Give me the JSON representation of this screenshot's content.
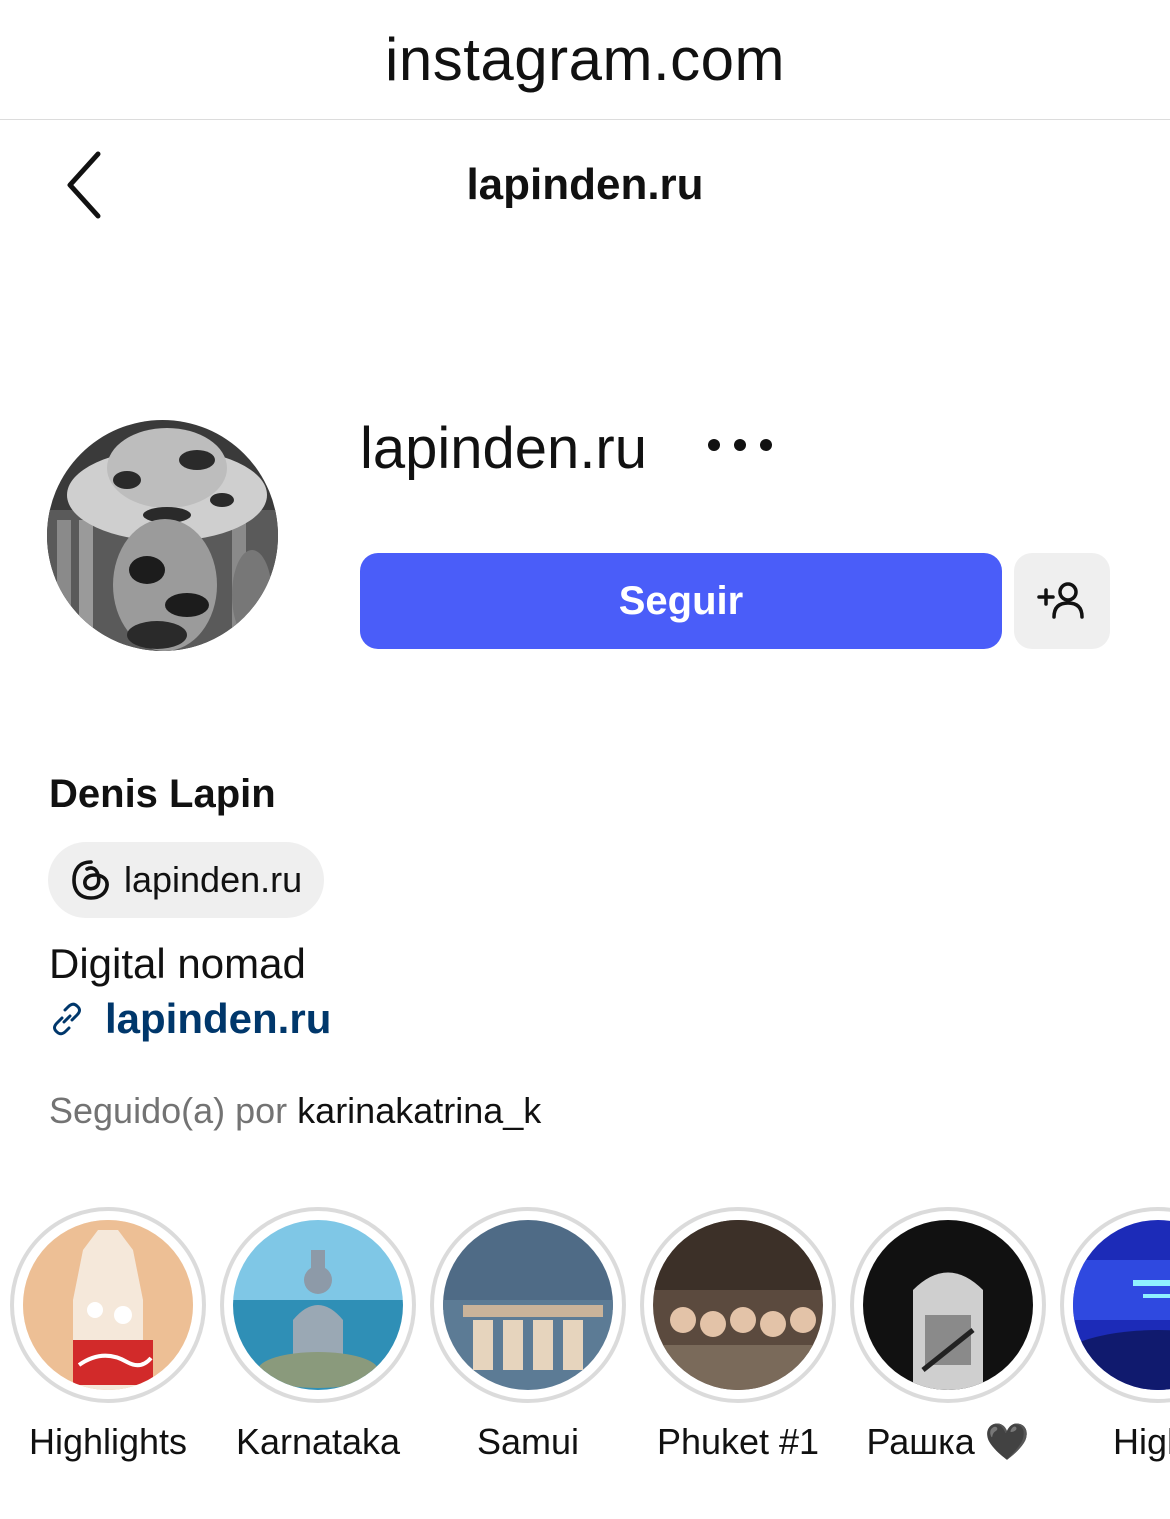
{
  "browser": {
    "url": "instagram.com"
  },
  "nav": {
    "title": "lapinden.ru",
    "back_icon": "chevron-left-icon"
  },
  "profile": {
    "username": "lapinden.ru",
    "follow_label": "Seguir",
    "full_name": "Denis Lapin",
    "threads_label": "lapinden.ru",
    "bio": "Digital nomad",
    "link_text": "lapinden.ru",
    "followed_by_prefix": "Seguido(a) por",
    "followed_by_user": "karinakatrina_k"
  },
  "colors": {
    "follow_button": "#4a5df9",
    "link": "#00376b",
    "secondary_text": "#737373",
    "chip_background": "#efefef"
  },
  "highlights": [
    {
      "label": "Highlights"
    },
    {
      "label": "Karnataka"
    },
    {
      "label": "Samui"
    },
    {
      "label": "Phuket #1"
    },
    {
      "label": "Рашка 🖤"
    },
    {
      "label": "Highli"
    }
  ]
}
